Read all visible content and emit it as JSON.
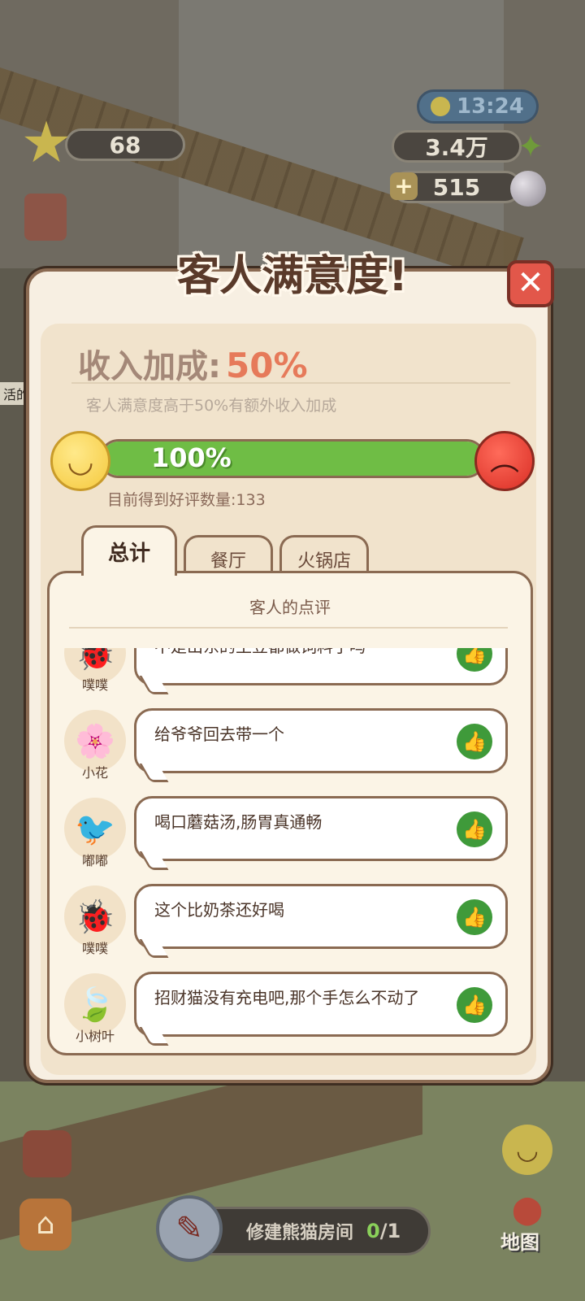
{
  "hud": {
    "star_count": "68",
    "time": "13:24",
    "bamboo": "3.4万",
    "pearls": "515",
    "side_label": "活的"
  },
  "dialog": {
    "title": "客人满意度!",
    "bonus_label": "收入加成:",
    "bonus_value": "50%",
    "bonus_hint": "客人满意度高于50%有额外收入加成",
    "progress_text": "100%",
    "progress_fraction": 1.0,
    "review_count_text": "目前得到好评数量:133"
  },
  "tabs": [
    {
      "label": "总计",
      "active": true
    },
    {
      "label": "餐厅",
      "active": false
    },
    {
      "label": "火锅店",
      "active": false
    }
  ],
  "reviews_panel": {
    "title": "客人的点评",
    "reviews": [
      {
        "name": "噗噗",
        "text": "不是山东的土豆都做饲料了吗",
        "avatar_icon": "bug-avatar"
      },
      {
        "name": "小花",
        "text": "给爷爷回去带一个",
        "avatar_icon": "flower-avatar"
      },
      {
        "name": "嘟嘟",
        "text": "喝口蘑菇汤,肠胃真通畅",
        "avatar_icon": "bird-avatar"
      },
      {
        "name": "噗噗",
        "text": "这个比奶茶还好喝",
        "avatar_icon": "bug-avatar"
      },
      {
        "name": "小树叶",
        "text": "招财猫没有充电吧,那个手怎么不动了",
        "avatar_icon": "leaf-avatar"
      }
    ]
  },
  "bottom": {
    "quest_label": "修建熊猫房间",
    "quest_done": "0",
    "quest_total": "/1",
    "map_label": "地图"
  },
  "colors": {
    "accent_green": "#6fbd45",
    "bonus_orange": "#e67a5a",
    "close_red": "#e2574a",
    "thumb_green": "#3f9a3a"
  }
}
